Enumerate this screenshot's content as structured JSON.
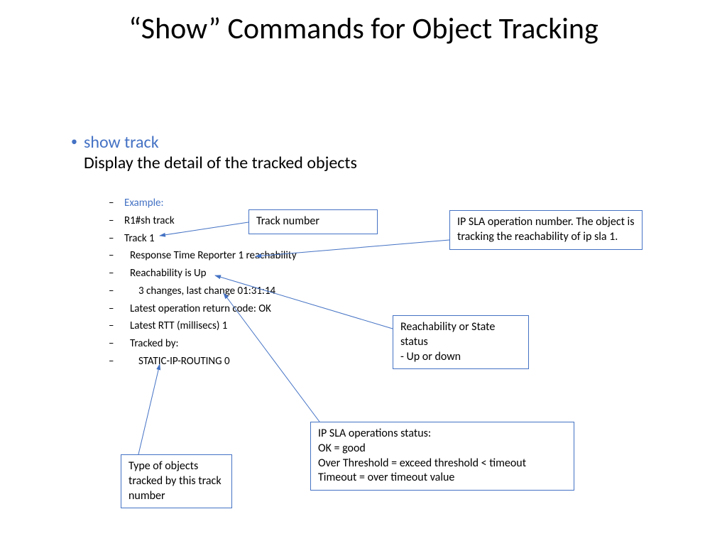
{
  "title": "“Show” Commands for Object Tracking",
  "command": "show track",
  "description": "Display the detail of the tracked objects",
  "example_label": "Example:",
  "output": {
    "line1": "R1#sh track",
    "line2": "Track 1",
    "line3": "Response Time Reporter 1 reachability",
    "line4": "Reachability is Up",
    "line5": "3 changes, last change 01:31:14",
    "line6": "Latest operation return code: OK",
    "line7": "Latest RTT (millisecs) 1",
    "line8": "Tracked by:",
    "line9": "STATIC-IP-ROUTING 0"
  },
  "callouts": {
    "track_number": "Track number",
    "ip_sla_num": "IP SLA operation number. The object is tracking the reachability of ip sla 1.",
    "reach_status": "Reachability or State status\n- Up or down",
    "op_status": "IP SLA operations status:\nOK = good\nOver Threshold = exceed threshold < timeout\nTimeout = over timeout value",
    "tracked_by": "Type of objects tracked by this track number"
  }
}
